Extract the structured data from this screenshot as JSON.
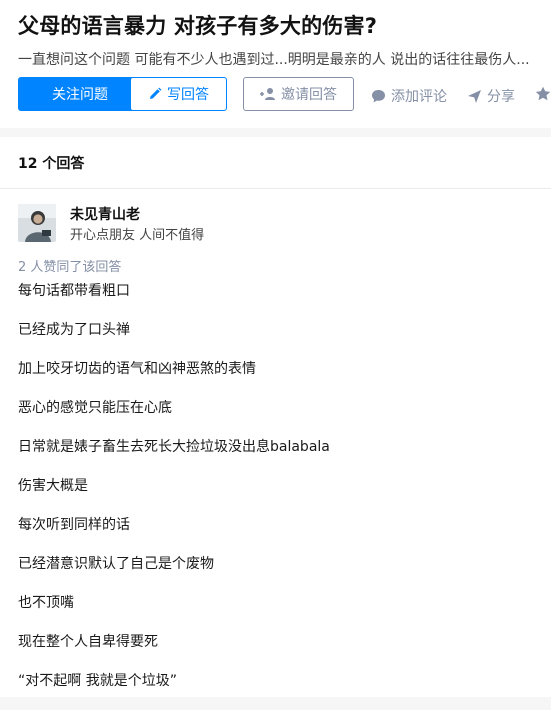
{
  "question": {
    "title": "父母的语言暴力 对孩子有多大的伤害?",
    "excerpt": "一直想问这个问题 可能有不少人也遇到过...明明是最亲的人 说出的话往往最伤人..."
  },
  "actions": {
    "follow": "关注问题",
    "write": "写回答",
    "invite": "邀请回答",
    "comment": "添加评论",
    "share": "分享"
  },
  "answers_count": "12 个回答",
  "answer": {
    "author_name": "未见青山老",
    "author_bio": "开心点朋友 人间不值得",
    "vote_note": "2 人赞同了该回答",
    "lines": [
      "每句话都带看粗口",
      "已经成为了口头禅",
      "加上咬牙切齿的语气和凶神恶煞的表情",
      "恶心的感觉只能压在心底",
      "日常就是婊子畜生去死长大捡垃圾没出息balabala",
      "伤害大概是",
      "每次听到同样的话",
      "已经潜意识默认了自己是个废物",
      "也不顶嘴",
      "现在整个人自卑得要死",
      "“对不起啊 我就是个垃圾”"
    ]
  },
  "colors": {
    "brand_blue": "#0084ff",
    "meta_gray": "#8590a6"
  },
  "icons": [
    "pencil-icon",
    "invite-person-icon",
    "comment-bubble-icon",
    "share-plane-icon",
    "star-icon"
  ]
}
